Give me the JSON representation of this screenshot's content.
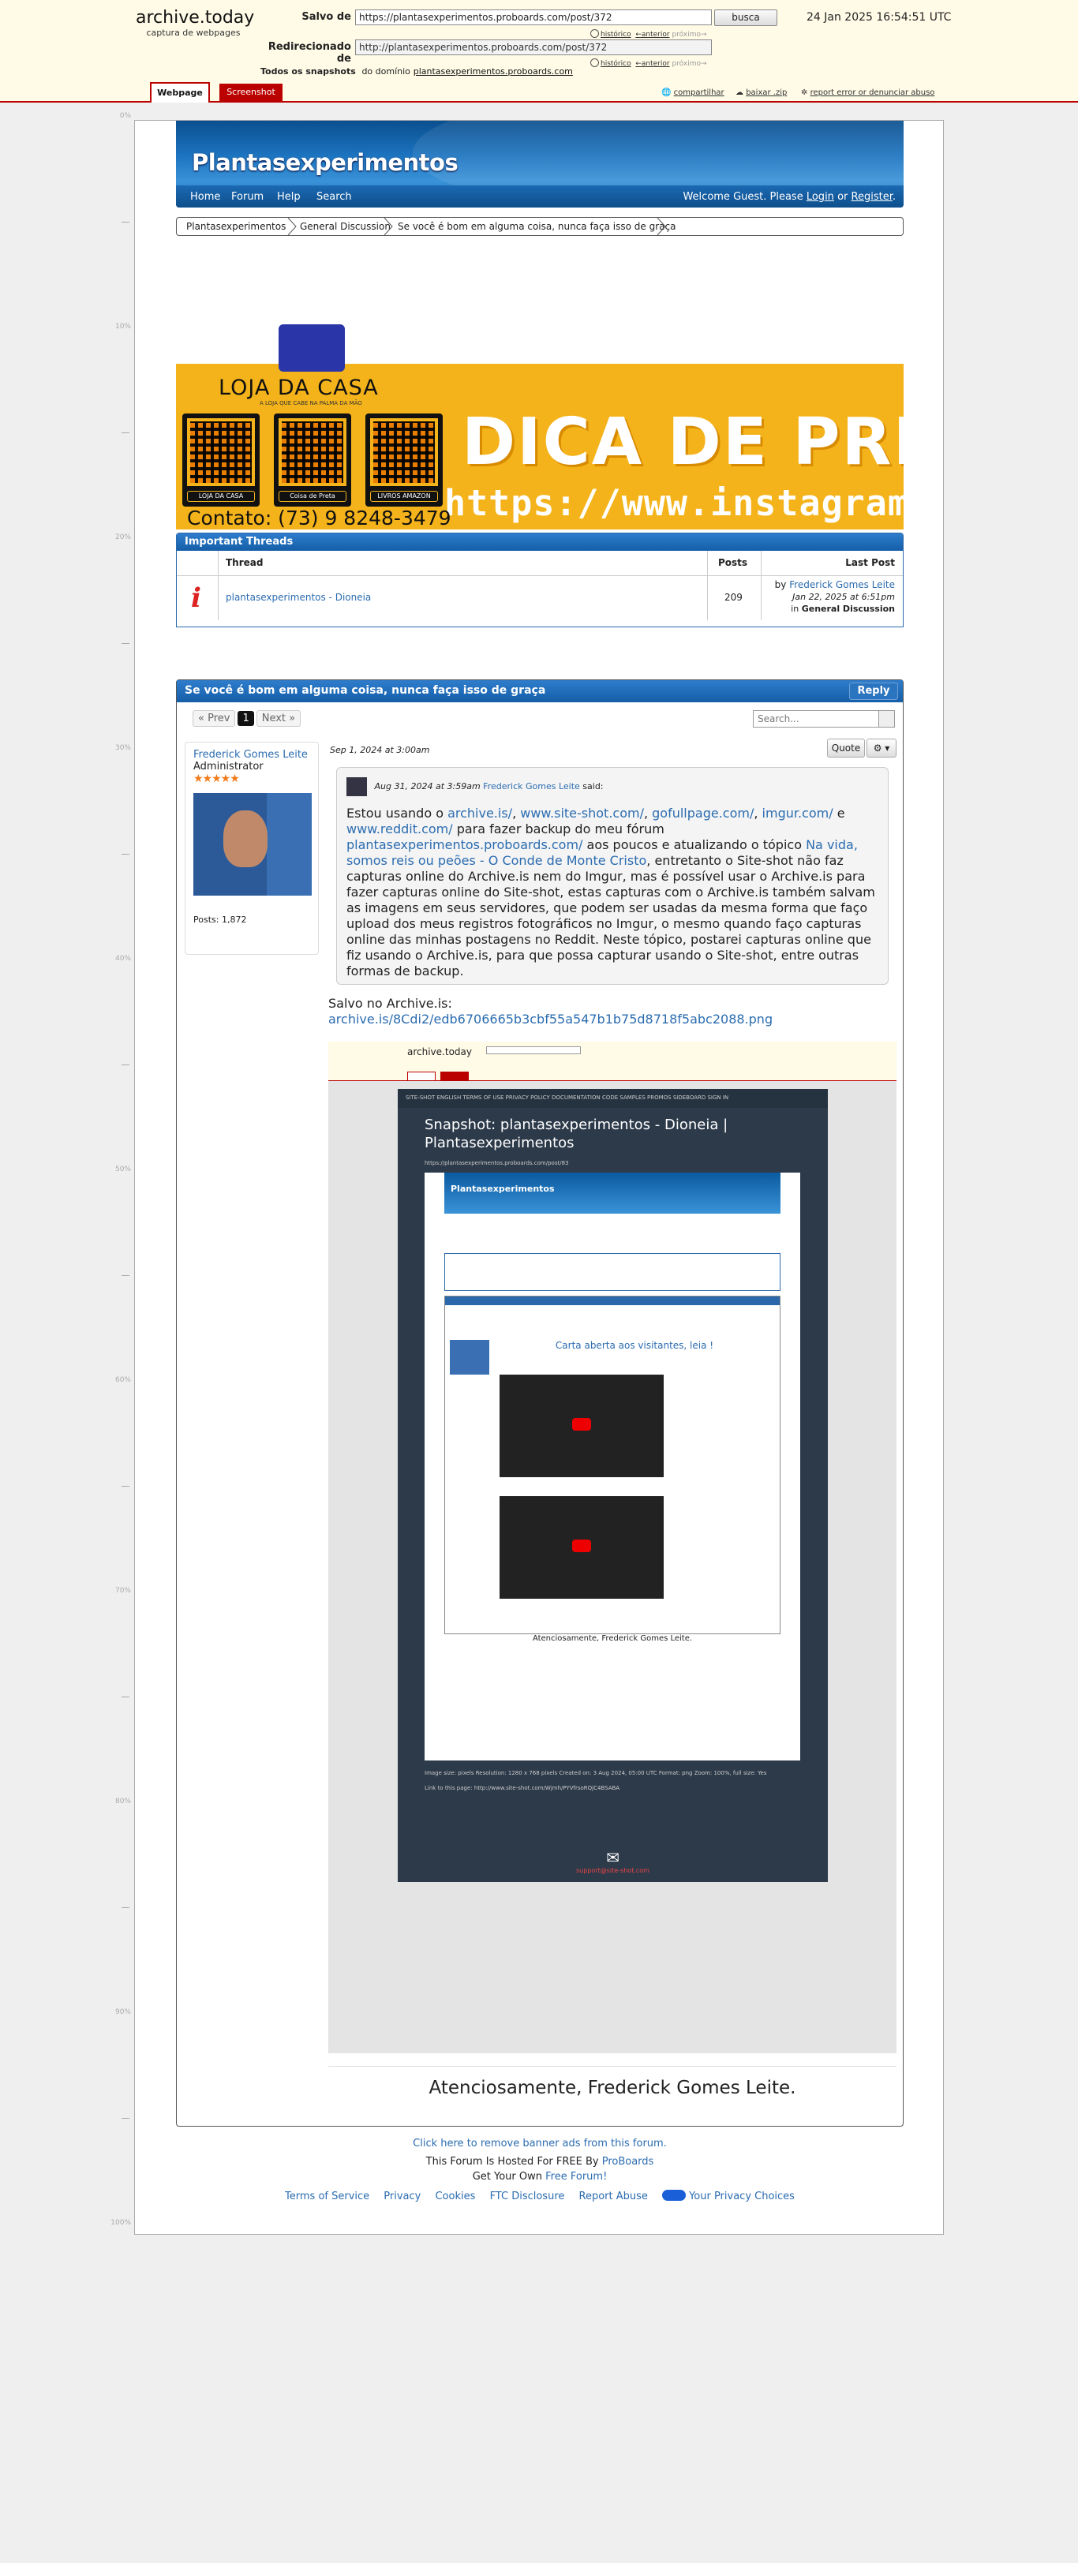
{
  "archive": {
    "logo_title": "archive.today",
    "logo_sub": "captura de webpages",
    "saved_from_label": "Salvo de",
    "saved_from_url": "https://plantasexperimentos.proboards.com/post/372",
    "search_button": "busca",
    "date": "24 Jan 2025 16:54:51 UTC",
    "redirected_label": "Redirecionado de",
    "redirected_url": "http://plantasexperimentos.proboards.com/post/372",
    "history": "histórico",
    "prev": "←anterior",
    "next": "próximo→",
    "snapshots_label": "Todos os snapshots",
    "snapshots_from": "do domínio",
    "snapshots_domain": "plantasexperimentos.proboards.com",
    "tab_webpage": "Webpage",
    "tab_screenshot": "Screenshot",
    "share": "compartilhar",
    "download": "baixar .zip",
    "report": "report error or denunciar abuso"
  },
  "ruler": [
    "0%",
    "10%",
    "20%",
    "30%",
    "40%",
    "50%",
    "60%",
    "70%",
    "80%",
    "90%",
    "100%"
  ],
  "forum": {
    "title": "Plantasexperimentos",
    "nav": [
      "Home",
      "Forum",
      "Help",
      "Search"
    ],
    "welcome_prefix": "Welcome Guest. Please",
    "login": "Login",
    "or": "or",
    "register": "Register",
    "breadcrumb": [
      "Plantasexperimentos",
      "General Discussion",
      "Se você é bom em alguma coisa, nunca faça isso de graça"
    ]
  },
  "banner": {
    "brand": "LOJA DA CASA",
    "brand_sub": "A LOJA QUE CABE NA PALMA DA MÃO",
    "qr_labels": [
      "LOJA DA CASA",
      "Coisa de Preta",
      "LIVROS AMAZON"
    ],
    "headline": "DICA DE PRESENTE",
    "instagram": "https://www.instagram.com/lo",
    "contact": "Contato: (73) 9 8248-3479"
  },
  "important": {
    "title": "Important Threads",
    "headers": [
      "Thread",
      "Posts",
      "Last Post"
    ],
    "thread": "plantasexperimentos - Dioneia",
    "posts": "209",
    "by": "by",
    "last_author": "Frederick Gomes Leite",
    "last_date": "Jan 22, 2025 at 6:51pm",
    "in": "in",
    "board": "General Discussion"
  },
  "thread": {
    "title": "Se você é bom em alguma coisa, nunca faça isso de graça",
    "reply": "Reply",
    "prev": "« Prev",
    "page": "1",
    "next": "Next »",
    "search_placeholder": "Search...",
    "user_name": "Frederick Gomes Leite",
    "user_role": "Administrator",
    "stars": "★★★★★",
    "posts_count": "Posts: 1,872",
    "post_date": "Sep 1, 2024 at 3:00am",
    "quote_button": "Quote",
    "quote_meta_date": "Aug 31, 2024 at 3:59am",
    "quote_meta_author": "Frederick Gomes Leite",
    "quote_meta_said": "said:",
    "q1": "Estou usando o",
    "l1": "archive.is/",
    "l2": "www.site-shot.com/",
    "l3": "gofullpage.com/",
    "l4": "imgur.com/",
    "q2": "e",
    "l5": "www.reddit.com/",
    "q3": "para fazer backup do meu fórum",
    "l6": "plantasexperimentos.proboards.com/",
    "q4": "aos poucos e atualizando o tópico",
    "l7": "Na vida, somos reis ou peões - O Conde de Monte Cristo",
    "q5": ", entretanto o Site-shot não faz capturas online do Archive.is nem do Imgur, mas é possível usar o Archive.is para fazer capturas online do Site-shot, estas capturas com o Archive.is também salvam as imagens em seus servidores, que podem ser usadas da mesma forma que faço upload dos meus registros fotográficos no Imgur, o mesmo quando faço capturas online das minhas postagens no Reddit. Neste tópico, postarei capturas online que fiz usando o Archive.is, para que possa capturar usando o Site-shot, entre outras formas de backup.",
    "saved_label": "Salvo no Archive.is:",
    "saved_link": "archive.is/8Cdi2/edb6706665b3cbf55a547b1b75d8718f5abc2088.png",
    "signature": "Atenciosamente, Frederick Gomes Leite."
  },
  "embedded": {
    "nav": "SITE-SHOT    ENGLISH    TERMS OF USE    PRIVACY POLICY    DOCUMENTATION    CODE SAMPLES    PROMOS    SIDEBOARD    SIGN IN",
    "title": "Snapshot: plantasexperimentos - Dioneia | Plantasexperimentos",
    "url": "https://plantasexperimentos.proboards.com/post/83",
    "forum": "Plantasexperimentos",
    "card": "Carta aberta aos visitantes, leia !",
    "sig": "Atenciosamente, Frederick Gomes Leite.",
    "meta": "Image size: pixels   Resolution: 1280 x 768 pixels   Created on: 3 Aug 2024, 05:00 UTC   Format: png   Zoom: 100%, full size: Yes",
    "link": "Link to this page: http://www.site-shot.com/Wjmh/PYVfrsoRQjC4BSABA",
    "mail": "support@site-shot.com"
  },
  "footer": {
    "remove_ads": "Click here to remove banner ads from this forum.",
    "hosted": "This Forum Is Hosted For FREE By",
    "proboards": "ProBoards",
    "get_own": "Get Your Own",
    "free_forum": "Free Forum!",
    "links": [
      "Terms of Service",
      "Privacy",
      "Cookies",
      "FTC Disclosure",
      "Report Abuse"
    ],
    "privacy_choices": "Your Privacy Choices"
  }
}
